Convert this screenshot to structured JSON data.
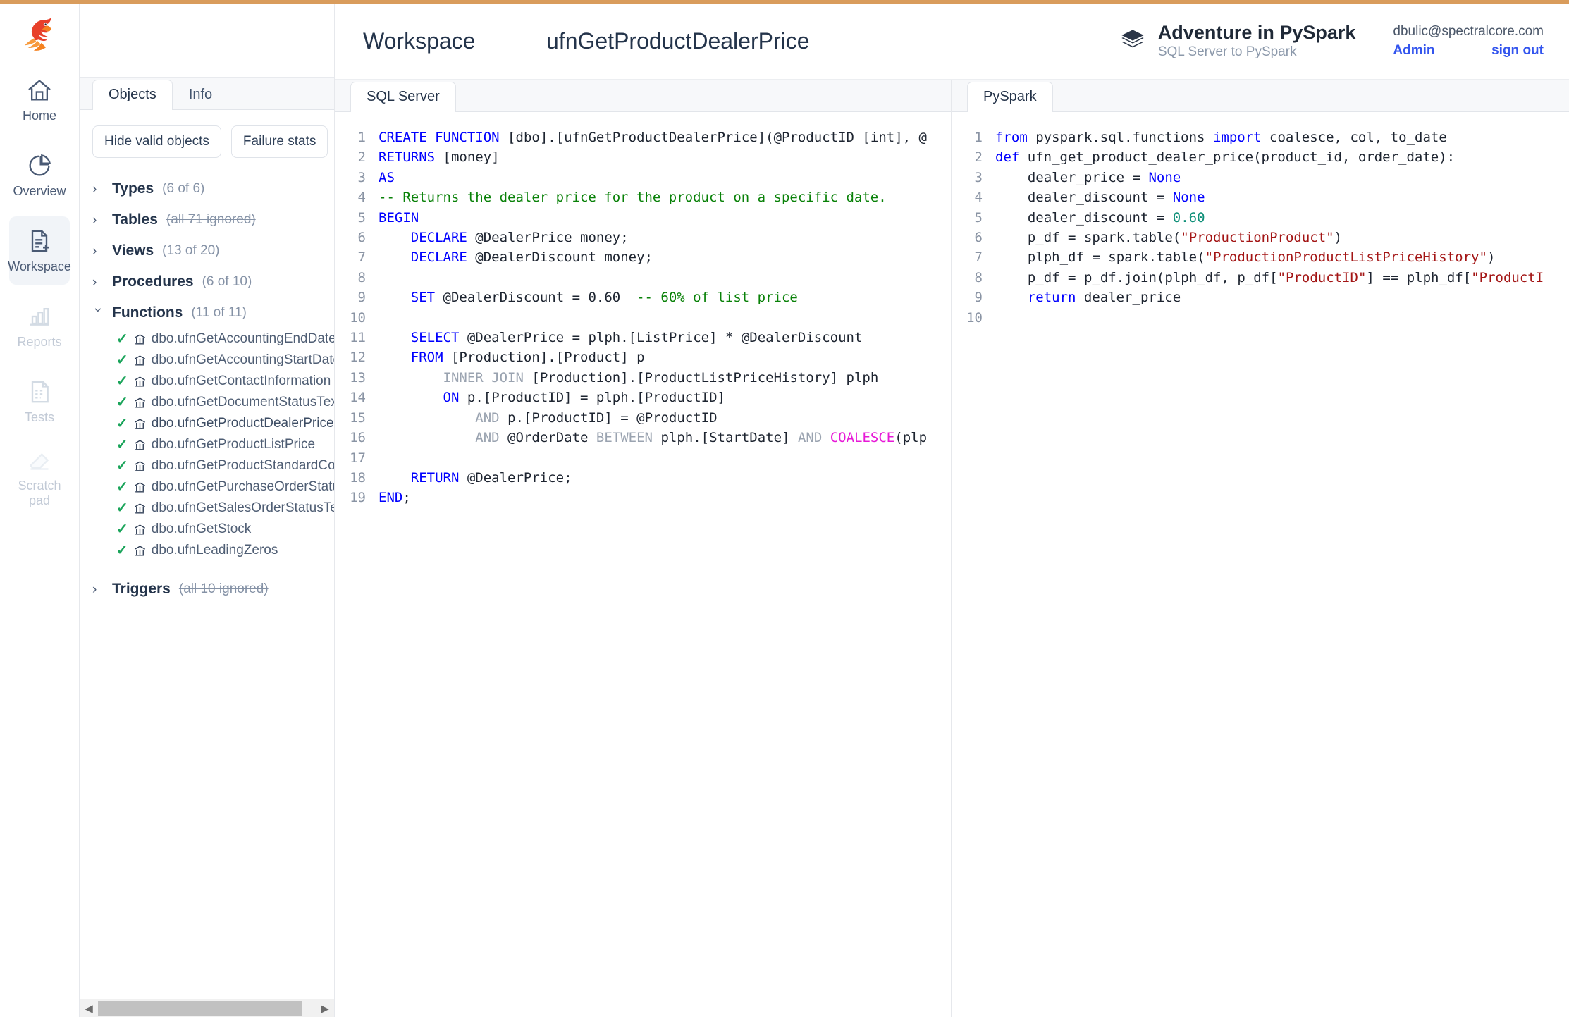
{
  "app": {
    "accent_color": "#d99c5c",
    "brand_name": "Adventure in PySpark",
    "brand_subtitle": "SQL Server to PySpark",
    "brand_icon": "layers-stack-icon",
    "logo_icon": "parrot-logo-icon"
  },
  "user": {
    "email": "dbulic@spectralcore.com",
    "admin_label": "Admin",
    "signout_label": "sign out",
    "link_color": "#3355ee"
  },
  "rail": {
    "items": [
      {
        "label": "Home",
        "icon": "home-icon",
        "state": "normal"
      },
      {
        "label": "Overview",
        "icon": "piechart-icon",
        "state": "normal"
      },
      {
        "label": "Workspace",
        "icon": "document-plus-icon",
        "state": "active"
      },
      {
        "label": "Reports",
        "icon": "bar-chart-icon",
        "state": "disabled"
      },
      {
        "label": "Tests",
        "icon": "test-doc-icon",
        "state": "disabled"
      },
      {
        "label": "Scratch pad",
        "icon": "eraser-icon",
        "state": "disabled"
      }
    ]
  },
  "objects_panel": {
    "tabs": [
      {
        "label": "Objects",
        "active": true
      },
      {
        "label": "Info",
        "active": false
      }
    ],
    "buttons": [
      {
        "label": "Hide valid objects"
      },
      {
        "label": "Failure stats"
      }
    ],
    "groups": [
      {
        "name": "Types",
        "count": "(6 of 6)",
        "ignored": false,
        "expanded": false
      },
      {
        "name": "Tables",
        "count": "(all 71 ignored)",
        "ignored": true,
        "expanded": false
      },
      {
        "name": "Views",
        "count": "(13 of 20)",
        "ignored": false,
        "expanded": false
      },
      {
        "name": "Procedures",
        "count": "(6 of 10)",
        "ignored": false,
        "expanded": false
      },
      {
        "name": "Functions",
        "count": "(11 of 11)",
        "ignored": false,
        "expanded": true
      },
      {
        "name": "Triggers",
        "count": "(all 10 ignored)",
        "ignored": true,
        "expanded": false
      }
    ],
    "functions": [
      {
        "name": "dbo.ufnGetAccountingEndDate",
        "status": "valid",
        "selected": false
      },
      {
        "name": "dbo.ufnGetAccountingStartDate",
        "status": "valid",
        "selected": false
      },
      {
        "name": "dbo.ufnGetContactInformation",
        "status": "valid",
        "selected": false
      },
      {
        "name": "dbo.ufnGetDocumentStatusText",
        "status": "valid",
        "selected": false
      },
      {
        "name": "dbo.ufnGetProductDealerPrice",
        "status": "valid",
        "selected": true
      },
      {
        "name": "dbo.ufnGetProductListPrice",
        "status": "valid",
        "selected": false
      },
      {
        "name": "dbo.ufnGetProductStandardCost",
        "status": "valid",
        "selected": false
      },
      {
        "name": "dbo.ufnGetPurchaseOrderStatusText",
        "status": "valid",
        "selected": false
      },
      {
        "name": "dbo.ufnGetSalesOrderStatusText",
        "status": "valid",
        "selected": false
      },
      {
        "name": "dbo.ufnGetStock",
        "status": "valid",
        "selected": false
      },
      {
        "name": "dbo.ufnLeadingZeros",
        "status": "valid",
        "selected": false
      }
    ],
    "scrollbar": {
      "left_arrow": "◀",
      "right_arrow": "▶"
    }
  },
  "header": {
    "workspace_label": "Workspace",
    "title": "ufnGetProductDealerPrice"
  },
  "sql_editor": {
    "tab_label": "SQL Server",
    "line_count": 19,
    "lines": [
      "CREATE FUNCTION [dbo].[ufnGetProductDealerPrice](@ProductID [int], @",
      "RETURNS [money]",
      "AS",
      "-- Returns the dealer price for the product on a specific date.",
      "BEGIN",
      "    DECLARE @DealerPrice money;",
      "    DECLARE @DealerDiscount money;",
      "",
      "    SET @DealerDiscount = 0.60  -- 60% of list price",
      "",
      "    SELECT @DealerPrice = plph.[ListPrice] * @DealerDiscount",
      "    FROM [Production].[Product] p",
      "        INNER JOIN [Production].[ProductListPriceHistory] plph",
      "        ON p.[ProductID] = plph.[ProductID]",
      "            AND p.[ProductID] = @ProductID",
      "            AND @OrderDate BETWEEN plph.[StartDate] AND COALESCE(plp",
      "",
      "    RETURN @DealerPrice;",
      "END;"
    ]
  },
  "pyspark_editor": {
    "tab_label": "PySpark",
    "line_count": 10,
    "lines": [
      "from pyspark.sql.functions import coalesce, col, to_date",
      "def ufn_get_product_dealer_price(product_id, order_date):",
      "    dealer_price = None",
      "    dealer_discount = None",
      "    dealer_discount = 0.60",
      "    p_df = spark.table(\"ProductionProduct\")",
      "    plph_df = spark.table(\"ProductionProductListPriceHistory\")",
      "    p_df = p_df.join(plph_df, p_df[\"ProductID\"] == plph_df[\"ProductI",
      "    return dealer_price",
      ""
    ]
  },
  "syntax_colors": {
    "keyword": "#0000ff",
    "comment": "#098108",
    "function": "#e719d7",
    "string": "#a31515",
    "number": "#0e8f78",
    "dim_keyword": "#9aa3b0",
    "plain": "#1d2430"
  }
}
